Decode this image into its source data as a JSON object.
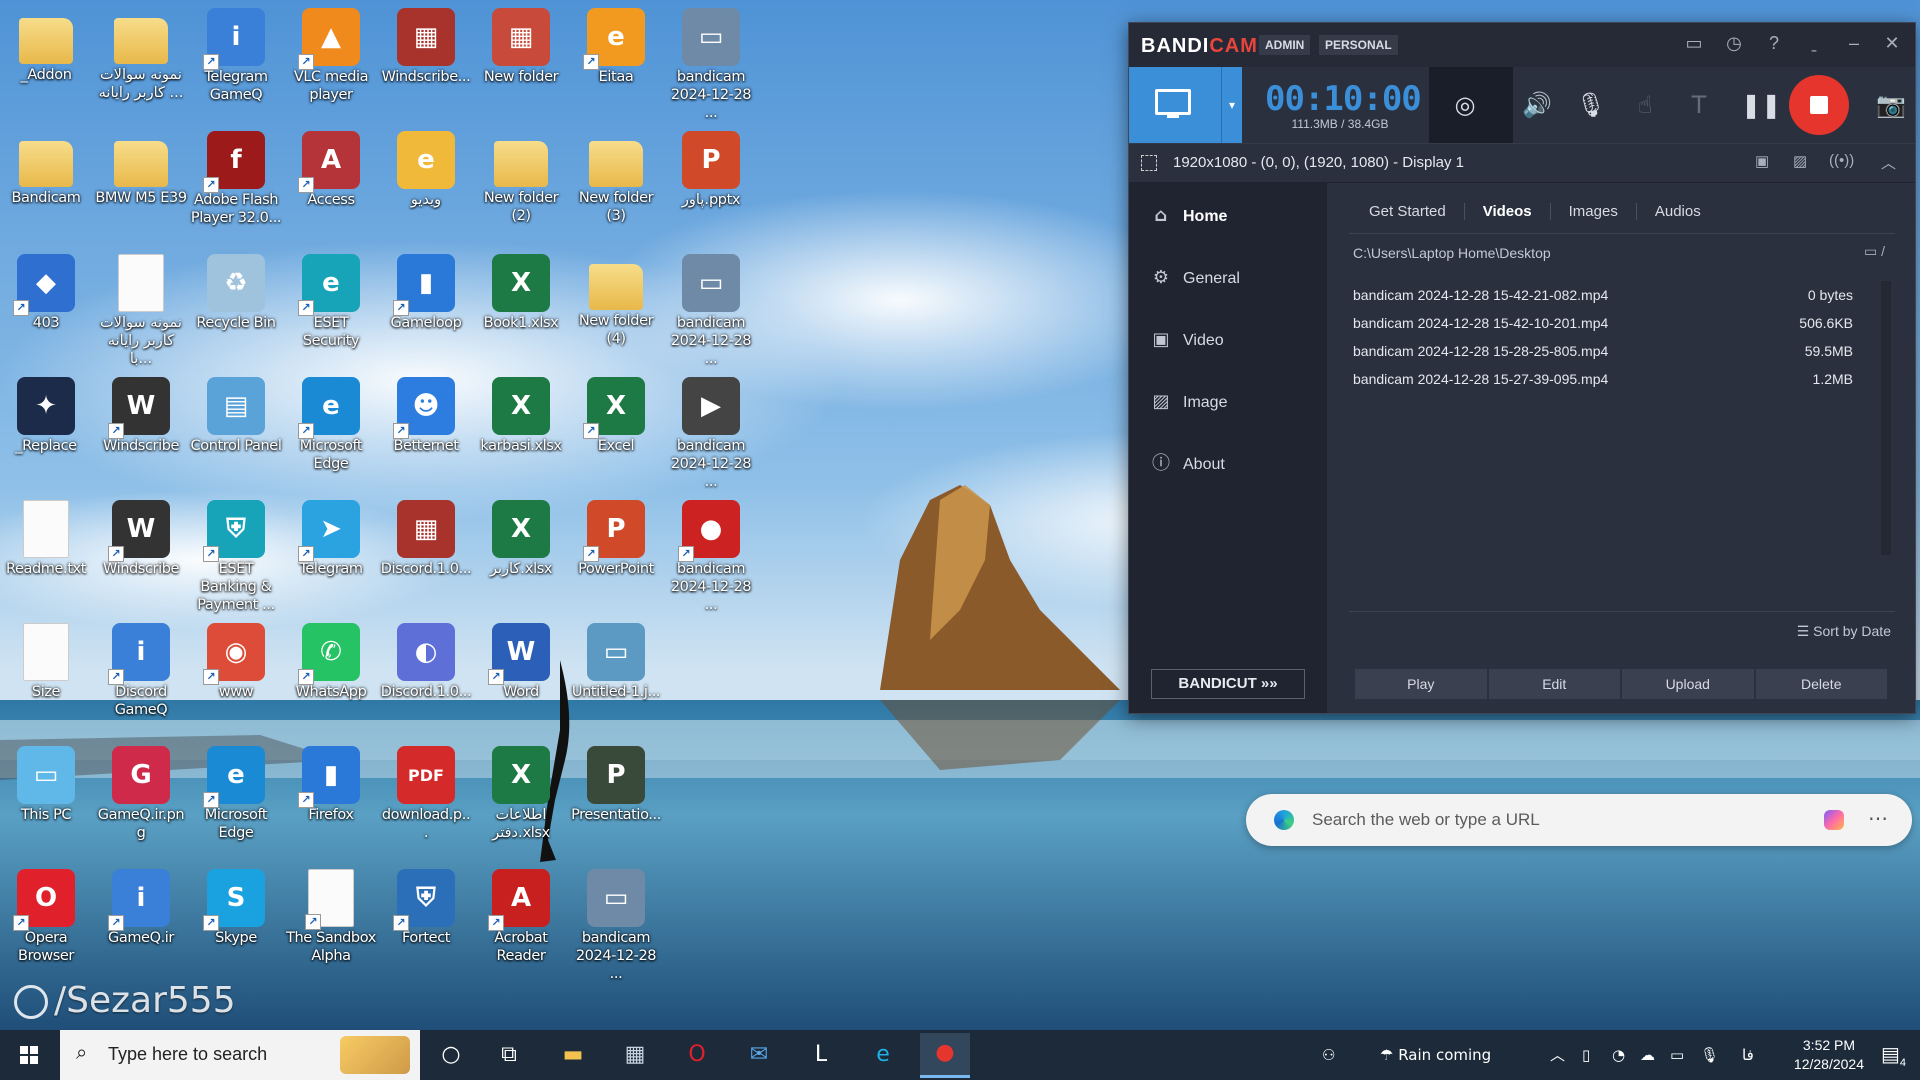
{
  "desktop": {
    "watermark": "/Sezar555",
    "icons": [
      {
        "label": "_Addon",
        "kind": "folder",
        "color": "#e8b84a",
        "glyph": "",
        "shortcut": false
      },
      {
        "label": "نمونه سوالات کاربر رایانه ...",
        "kind": "folder",
        "color": "#e8b84a",
        "glyph": "",
        "shortcut": false
      },
      {
        "label": "Telegram GameQ",
        "kind": "app",
        "color": "#3a7fd8",
        "glyph": "i",
        "shortcut": true
      },
      {
        "label": "VLC media player",
        "kind": "app",
        "color": "#f08a1c",
        "glyph": "▲",
        "shortcut": true
      },
      {
        "label": "Windscribe...",
        "kind": "app",
        "color": "#a8322c",
        "glyph": "▦",
        "shortcut": false
      },
      {
        "label": "New folder",
        "kind": "app",
        "color": "#c84a3a",
        "glyph": "▦",
        "shortcut": false
      },
      {
        "label": "Eitaa",
        "kind": "app",
        "color": "#f29a1f",
        "glyph": "e",
        "shortcut": true
      },
      {
        "label": "bandicam 2024-12-28 ...",
        "kind": "app",
        "color": "#6f8aa6",
        "glyph": "▭",
        "shortcut": false
      },
      {
        "label": "Bandicam",
        "kind": "folder",
        "color": "#e8b84a",
        "glyph": "",
        "shortcut": false
      },
      {
        "label": "BMW M5 E39",
        "kind": "folder",
        "color": "#e8b84a",
        "glyph": "",
        "shortcut": false
      },
      {
        "label": "Adobe Flash Player 32.0...",
        "kind": "app",
        "color": "#9c1a1a",
        "glyph": "f",
        "shortcut": true
      },
      {
        "label": "Access",
        "kind": "app",
        "color": "#b5343a",
        "glyph": "A",
        "shortcut": true
      },
      {
        "label": "ویدیو",
        "kind": "app",
        "color": "#f0b93a",
        "glyph": "e",
        "shortcut": false
      },
      {
        "label": "New folder (2)",
        "kind": "folder",
        "color": "#e8b84a",
        "glyph": "",
        "shortcut": false
      },
      {
        "label": "New folder (3)",
        "kind": "folder",
        "color": "#e8b84a",
        "glyph": "",
        "shortcut": false
      },
      {
        "label": "پاور.pptx",
        "kind": "app",
        "color": "#d04a2a",
        "glyph": "P",
        "shortcut": false
      },
      {
        "label": "403",
        "kind": "app",
        "color": "#2e6fd0",
        "glyph": "◆",
        "shortcut": true
      },
      {
        "label": "نمونه سوالات کاربر رایانه با...",
        "kind": "doc",
        "color": "#ffffff",
        "glyph": "",
        "shortcut": false
      },
      {
        "label": "Recycle Bin",
        "kind": "app",
        "color": "#9fc3dc",
        "glyph": "♻",
        "shortcut": false
      },
      {
        "label": "ESET Security",
        "kind": "app",
        "color": "#17a3b8",
        "glyph": "e",
        "shortcut": true
      },
      {
        "label": "Gameloop",
        "kind": "app",
        "color": "#2a78d8",
        "glyph": "▮",
        "shortcut": true
      },
      {
        "label": "Book1.xlsx",
        "kind": "app",
        "color": "#1e7a45",
        "glyph": "X",
        "shortcut": false
      },
      {
        "label": "New folder (4)",
        "kind": "folder",
        "color": "#e8b84a",
        "glyph": "",
        "shortcut": false
      },
      {
        "label": "bandicam 2024-12-28 ...",
        "kind": "app",
        "color": "#6f8aa6",
        "glyph": "▭",
        "shortcut": false
      },
      {
        "label": "_Replace",
        "kind": "app",
        "color": "#1c2b4a",
        "glyph": "✦",
        "shortcut": false
      },
      {
        "label": "Windscribe",
        "kind": "app",
        "color": "#333333",
        "glyph": "W",
        "shortcut": true
      },
      {
        "label": "Control Panel",
        "kind": "app",
        "color": "#5aa3d8",
        "glyph": "▤",
        "shortcut": false
      },
      {
        "label": "Microsoft Edge",
        "kind": "app",
        "color": "#1a8ad4",
        "glyph": "e",
        "shortcut": true
      },
      {
        "label": "Betternet",
        "kind": "app",
        "color": "#2d7de0",
        "glyph": "☻",
        "shortcut": true
      },
      {
        "label": "karbasi.xlsx",
        "kind": "app",
        "color": "#1e7a45",
        "glyph": "X",
        "shortcut": false
      },
      {
        "label": "Excel",
        "kind": "app",
        "color": "#1e7a45",
        "glyph": "X",
        "shortcut": true
      },
      {
        "label": "bandicam 2024-12-28 ...",
        "kind": "app",
        "color": "#444444",
        "glyph": "▶",
        "shortcut": false
      },
      {
        "label": "Readme.txt",
        "kind": "doc",
        "color": "#ffffff",
        "glyph": "",
        "shortcut": false
      },
      {
        "label": "Windscribe",
        "kind": "app",
        "color": "#333333",
        "glyph": "W",
        "shortcut": true
      },
      {
        "label": "ESET Banking & Payment ...",
        "kind": "app",
        "color": "#17a3b8",
        "glyph": "⛨",
        "shortcut": true
      },
      {
        "label": "Telegram",
        "kind": "app",
        "color": "#2aa3e0",
        "glyph": "➤",
        "shortcut": true
      },
      {
        "label": "Discord.1.0...",
        "kind": "app",
        "color": "#a8322c",
        "glyph": "▦",
        "shortcut": false
      },
      {
        "label": "کاربر.xlsx",
        "kind": "app",
        "color": "#1e7a45",
        "glyph": "X",
        "shortcut": false
      },
      {
        "label": "PowerPoint",
        "kind": "app",
        "color": "#d04a2a",
        "glyph": "P",
        "shortcut": true
      },
      {
        "label": "bandicam 2024-12-28 ...",
        "kind": "app",
        "color": "#cc2222",
        "glyph": "●",
        "shortcut": true
      },
      {
        "label": "Size",
        "kind": "doc",
        "color": "#ffffff",
        "glyph": "",
        "shortcut": false
      },
      {
        "label": "Discord GameQ",
        "kind": "app",
        "color": "#3a7fd8",
        "glyph": "i",
        "shortcut": true
      },
      {
        "label": "www",
        "kind": "app",
        "color": "#dd4b39",
        "glyph": "◉",
        "shortcut": true
      },
      {
        "label": "WhatsApp",
        "kind": "app",
        "color": "#25c363",
        "glyph": "✆",
        "shortcut": true
      },
      {
        "label": "Discord.1.0...",
        "kind": "app",
        "color": "#5e6fd8",
        "glyph": "◐",
        "shortcut": false
      },
      {
        "label": "Word",
        "kind": "app",
        "color": "#2b5fb8",
        "glyph": "W",
        "shortcut": true
      },
      {
        "label": "Untitled-1.j...",
        "kind": "app",
        "color": "#5c9ac4",
        "glyph": "▭",
        "shortcut": false
      },
      {
        "label": "",
        "kind": "none",
        "color": "",
        "glyph": "",
        "shortcut": false
      },
      {
        "label": "This PC",
        "kind": "app",
        "color": "#5fb8e8",
        "glyph": "▭",
        "shortcut": false
      },
      {
        "label": "GameQ.ir.png",
        "kind": "app",
        "color": "#d02a4a",
        "glyph": "G",
        "shortcut": false
      },
      {
        "label": "Microsoft Edge",
        "kind": "app",
        "color": "#1a8ad4",
        "glyph": "e",
        "shortcut": true
      },
      {
        "label": "Firefox",
        "kind": "app",
        "color": "#2a78d8",
        "glyph": "▮",
        "shortcut": true
      },
      {
        "label": "download.p...",
        "kind": "app",
        "color": "#d42a2a",
        "glyph": "PDF",
        "shortcut": false
      },
      {
        "label": "اطلاعات دفتر.xlsx",
        "kind": "app",
        "color": "#1e7a45",
        "glyph": "X",
        "shortcut": false
      },
      {
        "label": "Presentatio...",
        "kind": "app",
        "color": "#3a4a3a",
        "glyph": "P",
        "shortcut": false
      },
      {
        "label": "",
        "kind": "none",
        "color": "",
        "glyph": "",
        "shortcut": false
      },
      {
        "label": "Opera Browser",
        "kind": "app",
        "color": "#e0202a",
        "glyph": "O",
        "shortcut": true
      },
      {
        "label": "GameQ.ir",
        "kind": "app",
        "color": "#3a7fd8",
        "glyph": "i",
        "shortcut": true
      },
      {
        "label": "Skype",
        "kind": "app",
        "color": "#1aa1e0",
        "glyph": "S",
        "shortcut": true
      },
      {
        "label": "The Sandbox Alpha",
        "kind": "doc",
        "color": "#ffffff",
        "glyph": "",
        "shortcut": true
      },
      {
        "label": "Fortect",
        "kind": "app",
        "color": "#2a6fb8",
        "glyph": "⛨",
        "shortcut": true
      },
      {
        "label": "Acrobat Reader",
        "kind": "app",
        "color": "#c8201e",
        "glyph": "A",
        "shortcut": true
      },
      {
        "label": "bandicam 2024-12-28 ...",
        "kind": "app",
        "color": "#6f8aa6",
        "glyph": "▭",
        "shortcut": false
      }
    ]
  },
  "bandicam": {
    "logo_a": "BANDI",
    "logo_b": "CAM",
    "tag_admin": "ADMIN",
    "tag_personal": "PERSONAL",
    "timer": "00:10:00",
    "size": "111.3MB / 38.4GB",
    "region": "1920x1080 - (0, 0), (1920, 1080) - Display 1",
    "sidebar": [
      {
        "label": "Home",
        "icon": "⌂",
        "active": true
      },
      {
        "label": "General",
        "icon": "⚙",
        "active": false
      },
      {
        "label": "Video",
        "icon": "▣",
        "active": false
      },
      {
        "label": "Image",
        "icon": "▨",
        "active": false
      },
      {
        "label": "About",
        "icon": "ⓘ",
        "active": false
      }
    ],
    "bandicut": "BANDICUT »»",
    "tabs": [
      "Get Started",
      "Videos",
      "Images",
      "Audios"
    ],
    "active_tab": "Videos",
    "path": "C:\\Users\\Laptop Home\\Desktop",
    "files": [
      {
        "name": "bandicam 2024-12-28 15-42-21-082.mp4",
        "size": "0 bytes"
      },
      {
        "name": "bandicam 2024-12-28 15-42-10-201.mp4",
        "size": "506.6KB"
      },
      {
        "name": "bandicam 2024-12-28 15-28-25-805.mp4",
        "size": "59.5MB"
      },
      {
        "name": "bandicam 2024-12-28 15-27-39-095.mp4",
        "size": "1.2MB"
      }
    ],
    "sort": "Sort by Date",
    "actions": [
      "Play",
      "Edit",
      "Upload",
      "Delete"
    ],
    "accent": "#3b8ed8",
    "record_color": "#e5352d"
  },
  "edge": {
    "placeholder": "Search the web or type a URL"
  },
  "taskbar": {
    "search_text": "Type here to search",
    "weather": "Rain coming",
    "time": "3:52 PM",
    "date": "12/28/2024",
    "lang": "فا",
    "notifications": "4"
  }
}
